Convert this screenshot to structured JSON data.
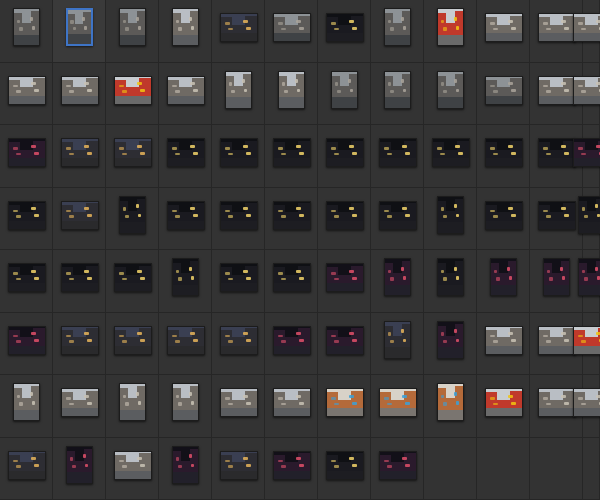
{
  "browser": {
    "columns": 12,
    "rows": 8,
    "selected_index": 1,
    "palettes": {
      "day": {
        "sky": "#b9bec4",
        "road": "#5b5d60",
        "bldg": "#6f6a64",
        "glow": "#c9c2b4"
      },
      "rain": {
        "sky": "#8d9296",
        "road": "#3f4245",
        "bldg": "#5c5a58",
        "glow": "#a9a39a"
      },
      "dusk": {
        "sky": "#3a3f52",
        "road": "#2a2a2c",
        "bldg": "#2d2d33",
        "glow": "#e6b45a"
      },
      "night": {
        "sky": "#0f1014",
        "road": "#1d1d22",
        "bldg": "#1a1a20",
        "glow": "#f2d36a"
      },
      "neon": {
        "sky": "#121018",
        "road": "#22202a",
        "bldg": "#2a1a2c",
        "glow": "#e0506a"
      },
      "color": {
        "sky": "#c8ccd0",
        "road": "#6a6a6a",
        "bldg": "#c0392b",
        "glow": "#f1c40f"
      },
      "shop": {
        "sky": "#d8d2c8",
        "road": "#7a7570",
        "bldg": "#b46a3a",
        "glow": "#3aa0d8"
      }
    },
    "thumbnails": [
      {
        "orientation": "portrait",
        "palette": "rain"
      },
      {
        "orientation": "portrait",
        "palette": "rain"
      },
      {
        "orientation": "portrait",
        "palette": "rain"
      },
      {
        "orientation": "portrait",
        "palette": "day"
      },
      {
        "orientation": "landscape",
        "palette": "dusk"
      },
      {
        "orientation": "landscape",
        "palette": "rain"
      },
      {
        "orientation": "landscape",
        "palette": "night"
      },
      {
        "orientation": "portrait",
        "palette": "rain"
      },
      {
        "orientation": "portrait",
        "palette": "color"
      },
      {
        "orientation": "landscape",
        "palette": "day"
      },
      {
        "orientation": "landscape",
        "palette": "day"
      },
      {
        "orientation": "landscape",
        "palette": "day"
      },
      {
        "orientation": "landscape",
        "palette": "day"
      },
      {
        "orientation": "landscape",
        "palette": "day"
      },
      {
        "orientation": "landscape",
        "palette": "color"
      },
      {
        "orientation": "landscape",
        "palette": "day"
      },
      {
        "orientation": "portrait",
        "palette": "day"
      },
      {
        "orientation": "portrait",
        "palette": "day"
      },
      {
        "orientation": "portrait",
        "palette": "rain"
      },
      {
        "orientation": "portrait",
        "palette": "rain"
      },
      {
        "orientation": "portrait",
        "palette": "rain"
      },
      {
        "orientation": "landscape",
        "palette": "rain"
      },
      {
        "orientation": "landscape",
        "palette": "day"
      },
      {
        "orientation": "landscape",
        "palette": "day"
      },
      {
        "orientation": "landscape",
        "palette": "neon"
      },
      {
        "orientation": "landscape",
        "palette": "dusk"
      },
      {
        "orientation": "landscape",
        "palette": "dusk"
      },
      {
        "orientation": "landscape",
        "palette": "night"
      },
      {
        "orientation": "landscape",
        "palette": "night"
      },
      {
        "orientation": "landscape",
        "palette": "night"
      },
      {
        "orientation": "landscape",
        "palette": "night"
      },
      {
        "orientation": "landscape",
        "palette": "night"
      },
      {
        "orientation": "landscape",
        "palette": "night"
      },
      {
        "orientation": "landscape",
        "palette": "night"
      },
      {
        "orientation": "landscape",
        "palette": "night"
      },
      {
        "orientation": "landscape",
        "palette": "neon"
      },
      {
        "orientation": "landscape",
        "palette": "night"
      },
      {
        "orientation": "landscape",
        "palette": "dusk"
      },
      {
        "orientation": "portrait",
        "palette": "night"
      },
      {
        "orientation": "landscape",
        "palette": "night"
      },
      {
        "orientation": "landscape",
        "palette": "night"
      },
      {
        "orientation": "landscape",
        "palette": "night"
      },
      {
        "orientation": "landscape",
        "palette": "night"
      },
      {
        "orientation": "landscape",
        "palette": "night"
      },
      {
        "orientation": "portrait",
        "palette": "night"
      },
      {
        "orientation": "landscape",
        "palette": "night"
      },
      {
        "orientation": "landscape",
        "palette": "night"
      },
      {
        "orientation": "portrait",
        "palette": "night"
      },
      {
        "orientation": "landscape",
        "palette": "night"
      },
      {
        "orientation": "landscape",
        "palette": "night"
      },
      {
        "orientation": "landscape",
        "palette": "night"
      },
      {
        "orientation": "portrait",
        "palette": "night"
      },
      {
        "orientation": "landscape",
        "palette": "night"
      },
      {
        "orientation": "landscape",
        "palette": "night"
      },
      {
        "orientation": "landscape",
        "palette": "neon"
      },
      {
        "orientation": "portrait",
        "palette": "neon"
      },
      {
        "orientation": "portrait",
        "palette": "night"
      },
      {
        "orientation": "portrait",
        "palette": "neon"
      },
      {
        "orientation": "portrait",
        "palette": "neon"
      },
      {
        "orientation": "portrait",
        "palette": "neon"
      },
      {
        "orientation": "landscape",
        "palette": "neon"
      },
      {
        "orientation": "landscape",
        "palette": "dusk"
      },
      {
        "orientation": "landscape",
        "palette": "dusk"
      },
      {
        "orientation": "landscape",
        "palette": "dusk"
      },
      {
        "orientation": "landscape",
        "palette": "dusk"
      },
      {
        "orientation": "landscape",
        "palette": "neon"
      },
      {
        "orientation": "landscape",
        "palette": "neon"
      },
      {
        "orientation": "portrait",
        "palette": "dusk"
      },
      {
        "orientation": "portrait",
        "palette": "neon"
      },
      {
        "orientation": "landscape",
        "palette": "day"
      },
      {
        "orientation": "landscape",
        "palette": "day"
      },
      {
        "orientation": "landscape",
        "palette": "color"
      },
      {
        "orientation": "portrait",
        "palette": "day"
      },
      {
        "orientation": "landscape",
        "palette": "day"
      },
      {
        "orientation": "portrait",
        "palette": "day"
      },
      {
        "orientation": "portrait",
        "palette": "day"
      },
      {
        "orientation": "landscape",
        "palette": "day"
      },
      {
        "orientation": "landscape",
        "palette": "day"
      },
      {
        "orientation": "landscape",
        "palette": "shop"
      },
      {
        "orientation": "landscape",
        "palette": "shop"
      },
      {
        "orientation": "portrait",
        "palette": "shop"
      },
      {
        "orientation": "landscape",
        "palette": "color"
      },
      {
        "orientation": "landscape",
        "palette": "day"
      },
      {
        "orientation": "landscape",
        "palette": "day"
      },
      {
        "orientation": "landscape",
        "palette": "dusk"
      },
      {
        "orientation": "portrait",
        "palette": "neon"
      },
      {
        "orientation": "landscape",
        "palette": "day"
      },
      {
        "orientation": "portrait",
        "palette": "neon"
      },
      {
        "orientation": "landscape",
        "palette": "dusk"
      },
      {
        "orientation": "landscape",
        "palette": "neon"
      },
      {
        "orientation": "landscape",
        "palette": "night"
      },
      {
        "orientation": "landscape",
        "palette": "neon"
      },
      {
        "orientation": null,
        "palette": null
      },
      {
        "orientation": null,
        "palette": null
      },
      {
        "orientation": null,
        "palette": null
      },
      {
        "orientation": null,
        "palette": null
      }
    ]
  }
}
